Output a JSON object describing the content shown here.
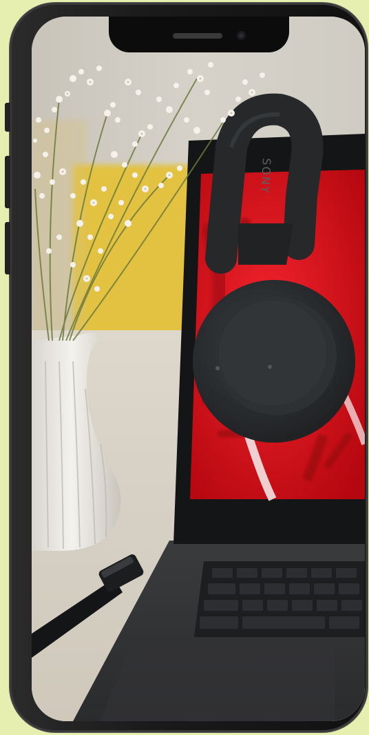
{
  "photo": {
    "subject": "headphones-on-laptop",
    "headphone_brand": "SONY"
  },
  "colors": {
    "background": "#e7efb0",
    "frame": "#1a1a1a",
    "laptop_screen_red": "#e0131c",
    "wall_yellow": "#e3c23c"
  }
}
